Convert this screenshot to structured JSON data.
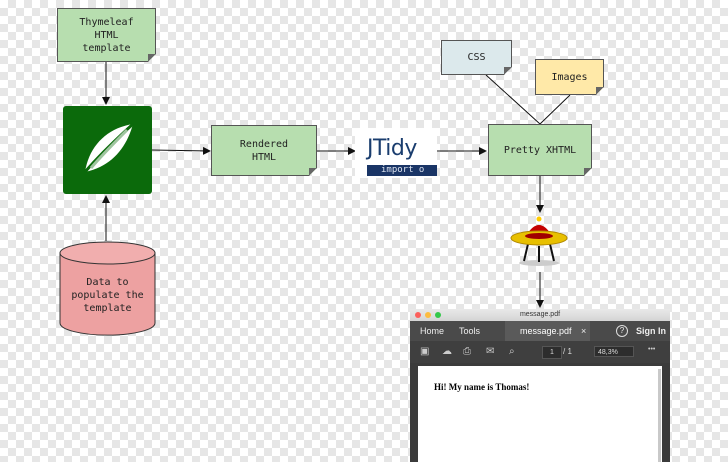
{
  "nodes": {
    "thymeleaf_template": "Thymeleaf\nHTML\ntemplate",
    "rendered_html": "Rendered\nHTML",
    "pretty_xhtml": "Pretty XHTML",
    "css": "CSS",
    "images": "Images",
    "data_to_populate": "Data to\npopulate the\ntemplate"
  },
  "jtidy": {
    "name": "JTidy",
    "tagline": "import o"
  },
  "pdf_viewer": {
    "window_title": "message.pdf",
    "tabs": {
      "home": "Home",
      "tools": "Tools",
      "document": "message.pdf",
      "close": "×"
    },
    "help": "?",
    "sign_in": "Sign In",
    "page_current": "1",
    "page_total": "/ 1",
    "zoom": "48,3%",
    "more": "•••",
    "content": "Hi! My name is Thomas!"
  },
  "colors": {
    "green_note": "#b7deaf",
    "blue_note": "#dce9ec",
    "yellow_note": "#ffe9a8",
    "thymeleaf_green": "#0b6a0b",
    "database_pink": "#eda1a1"
  }
}
